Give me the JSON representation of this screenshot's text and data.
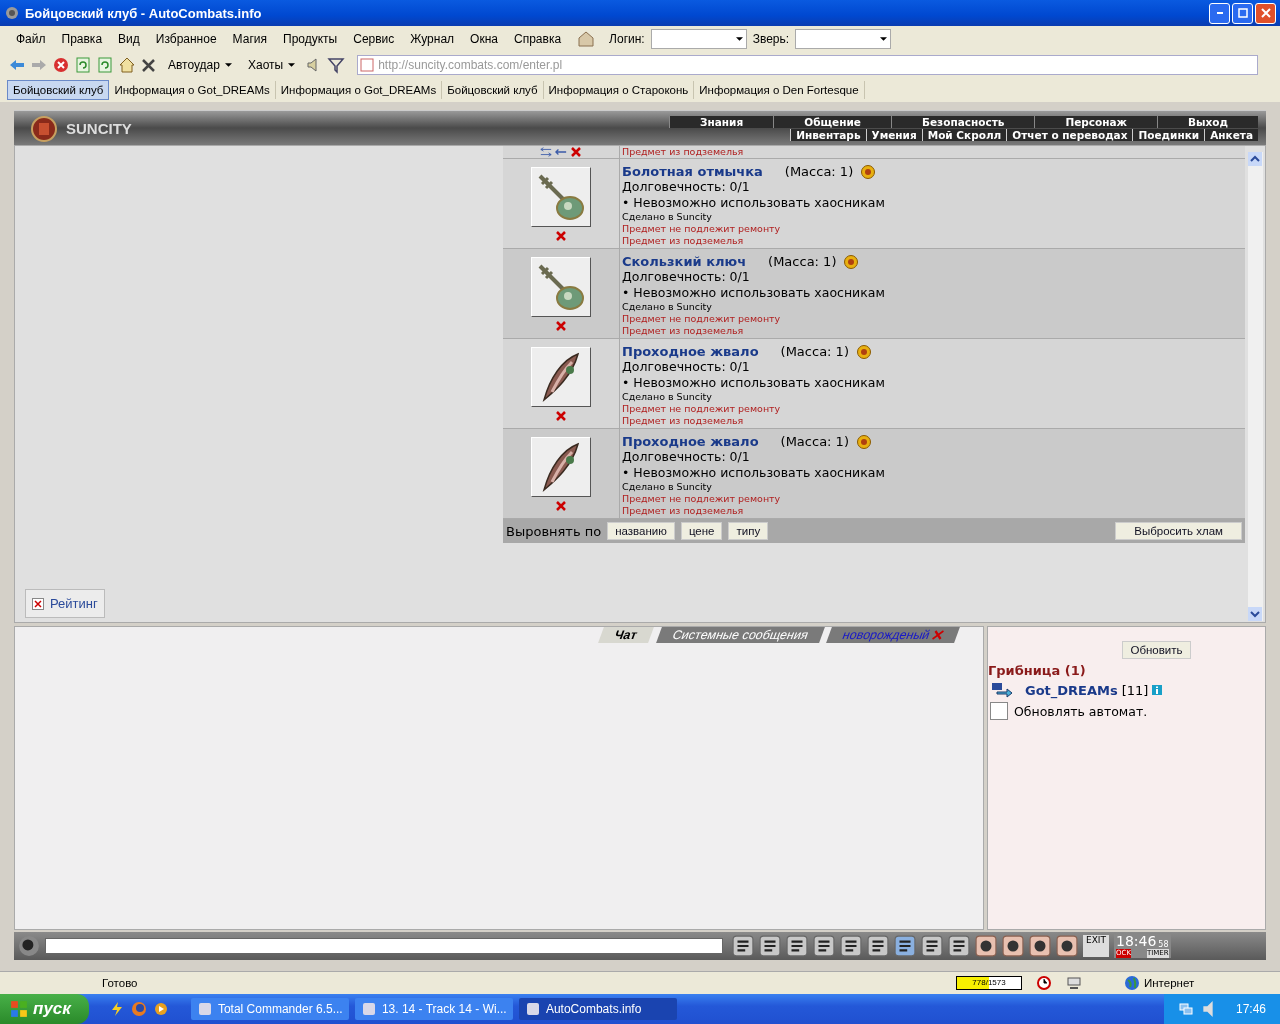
{
  "window": {
    "title": "Бойцовский клуб - AutoCombats.info"
  },
  "menu": [
    {
      "label": "Файл"
    },
    {
      "label": "Правка"
    },
    {
      "label": "Вид"
    },
    {
      "label": "Избранное"
    },
    {
      "label": "Магия"
    },
    {
      "label": "Продукты"
    },
    {
      "label": "Сервис"
    },
    {
      "label": "Журнал"
    },
    {
      "label": "Окна"
    },
    {
      "label": "Справка"
    }
  ],
  "login": {
    "label": "Логин:"
  },
  "pet": {
    "label": "Зверь:"
  },
  "toolbar": {
    "autohit": "Автоудар",
    "chaos": "Хаоты",
    "address": "http://suncity.combats.com/enter.pl"
  },
  "links": [
    {
      "label": "Бойцовский клуб",
      "selected": true
    },
    {
      "label": "Информация о Got_DREAMs",
      "selected": false
    },
    {
      "label": "Информация о Got_DREAMs",
      "selected": false
    },
    {
      "label": "Бойцовский клуб",
      "selected": false
    },
    {
      "label": "Информация о Староконь",
      "selected": false
    },
    {
      "label": "Информация о Den Fortesque",
      "selected": false
    }
  ],
  "game": {
    "logo": "SUNCITY",
    "nav_top": [
      "Знания",
      "Общение",
      "Безопасность",
      "Персонаж",
      "Выход"
    ],
    "nav_bottom": [
      "Инвентарь",
      "Умения",
      "Мой Скролл",
      "Отчет о переводах",
      "Поединки",
      "Анкета"
    ],
    "partial_row": {
      "note": "Предмет из подземелья"
    },
    "items": [
      {
        "kind": "key",
        "name": "Болотная отмычка",
        "weight": "(Масса: 1)",
        "durability": "Долговечность: 0/1",
        "restriction": "• Невозможно использовать хаосникам",
        "made": "Сделано в Suncity",
        "flags": [
          "Предмет не подлежит ремонту",
          "Предмет из подземелья"
        ]
      },
      {
        "kind": "key",
        "name": "Скользкий ключ",
        "weight": "(Масса: 1)",
        "durability": "Долговечность: 0/1",
        "restriction": "• Невозможно использовать хаосникам",
        "made": "Сделано в Suncity",
        "flags": [
          "Предмет не подлежит ремонту",
          "Предмет из подземелья"
        ]
      },
      {
        "kind": "sting",
        "name": "Проходное жвало",
        "weight": "(Масса: 1)",
        "durability": "Долговечность: 0/1",
        "restriction": "• Невозможно использовать хаосникам",
        "made": "Сделано в Suncity",
        "flags": [
          "Предмет не подлежит ремонту",
          "Предмет из подземелья"
        ]
      },
      {
        "kind": "sting",
        "name": "Проходное жвало",
        "weight": "(Масса: 1)",
        "durability": "Долговечность: 0/1",
        "restriction": "• Невозможно использовать хаосникам",
        "made": "Сделано в Suncity",
        "flags": [
          "Предмет не подлежит ремонту",
          "Предмет из подземелья"
        ]
      }
    ],
    "sort": {
      "label": "Выровнять по",
      "options": [
        "названию",
        "цене",
        "типу"
      ],
      "discard": "Выбросить хлам"
    },
    "rating": "Рейтинг",
    "chat_tabs": [
      {
        "label": "Чат",
        "selected": true,
        "kind": "plain"
      },
      {
        "label": "Системные сообщения",
        "selected": false,
        "kind": "plain"
      },
      {
        "label": "новорожденый",
        "selected": false,
        "kind": "closable"
      }
    ],
    "online": {
      "refresh": "Обновить",
      "room": "Грибница (1)",
      "users": [
        {
          "name": "Got_DREAMs",
          "level": "[11]"
        }
      ],
      "auto": {
        "label": "Обновлять автомат.",
        "checked": false
      }
    },
    "clock": {
      "time": "18:46",
      "seconds": "58",
      "exit": "EXIT",
      "ock": "OCK",
      "timer": "TIMER"
    }
  },
  "status": {
    "text": "Готово",
    "progress": {
      "reading": "778/1573",
      "level": 0.495
    },
    "zone": "Интернет"
  },
  "taskbar": {
    "start": "пуск",
    "tasks": [
      {
        "label": "Total Commander 6.5...",
        "selected": false
      },
      {
        "label": "13. 14 - Track 14 - Wi...",
        "selected": false
      },
      {
        "label": "AutoCombats.info",
        "selected": true
      }
    ],
    "time": "17:46"
  }
}
